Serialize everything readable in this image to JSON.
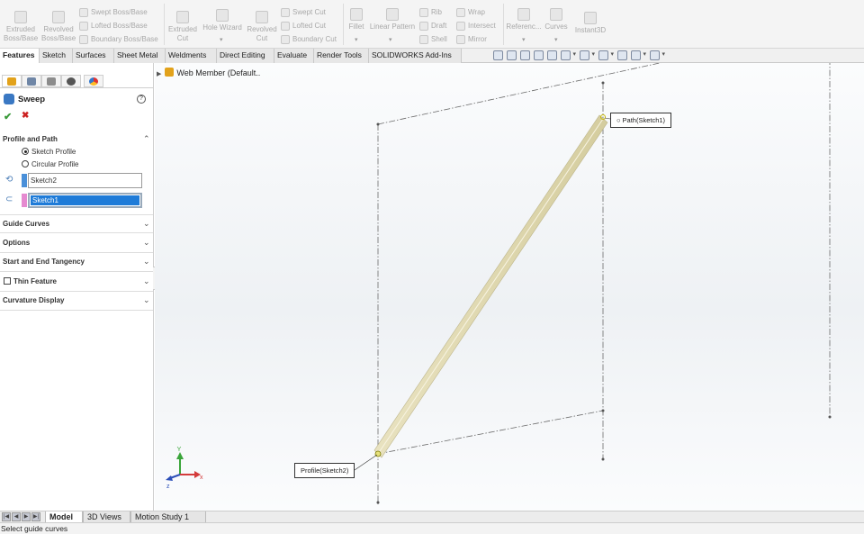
{
  "ribbon": {
    "extruded_boss": [
      "Extruded",
      "Boss/Base"
    ],
    "revolved_boss": [
      "Revolved",
      "Boss/Base"
    ],
    "swept_boss": "Swept Boss/Base",
    "lofted_boss": "Lofted Boss/Base",
    "boundary_boss": "Boundary Boss/Base",
    "extruded_cut": [
      "Extruded",
      "Cut"
    ],
    "hole_wizard": "Hole Wizard",
    "revolved_cut": [
      "Revolved",
      "Cut"
    ],
    "swept_cut": "Swept Cut",
    "lofted_cut": "Lofted Cut",
    "boundary_cut": "Boundary Cut",
    "fillet": "Fillet",
    "linear_pattern": "Linear Pattern",
    "rib": "Rib",
    "draft": "Draft",
    "shell": "Shell",
    "wrap": "Wrap",
    "intersect": "Intersect",
    "mirror": "Mirror",
    "reference": "Referenc...",
    "curves": "Curves",
    "instant3d": "Instant3D"
  },
  "tabs": [
    "Features",
    "Sketch",
    "Surfaces",
    "Sheet Metal",
    "Weldments",
    "Direct Editing",
    "Evaluate",
    "Render Tools",
    "SOLIDWORKS Add-Ins"
  ],
  "property_manager": {
    "title": "Sweep",
    "help": "?",
    "profile_and_path": "Profile and Path",
    "options": {
      "sketch_profile": "Sketch Profile",
      "circular_profile": "Circular Profile",
      "selected": "sketch_profile"
    },
    "profile_value": "Sketch2",
    "path_value": "Sketch1",
    "profile_color": "#4a90d9",
    "path_color": "#e58ad0",
    "sections": [
      "Guide Curves",
      "Options",
      "Start and End Tangency",
      "Thin Feature",
      "Curvature Display"
    ]
  },
  "graphics": {
    "tree_label": "Web Member  (Default..",
    "path_callout": "Path(Sketch1)",
    "profile_callout": "Profile(Sketch2)",
    "axis_y": "Y",
    "member_color": "#e8e2bf"
  },
  "bottom": {
    "tabs": [
      "Model",
      "3D Views",
      "Motion Study 1"
    ],
    "status": "Select guide curves"
  }
}
